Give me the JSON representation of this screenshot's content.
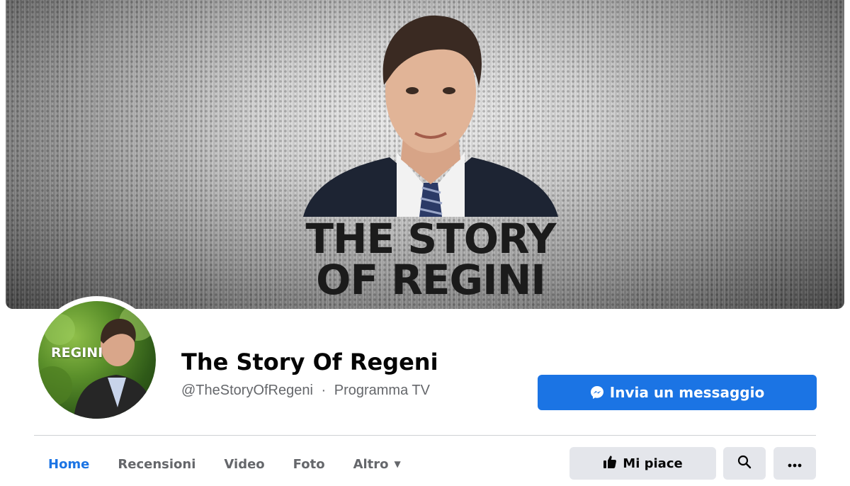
{
  "cover": {
    "title_line1": "THE STORY",
    "title_line2": "OF REGINI"
  },
  "avatar": {
    "label": "REGINI"
  },
  "page": {
    "name": "The Story Of Regeni",
    "handle": "@TheStoryOfRegeni",
    "separator": "·",
    "category": "Programma TV"
  },
  "actions": {
    "message_label": "Invia un messaggio",
    "like_label": "Mi piace",
    "search_icon": "search-icon",
    "more_icon": "more-dots-icon"
  },
  "tabs": [
    {
      "label": "Home",
      "active": true
    },
    {
      "label": "Recensioni",
      "active": false
    },
    {
      "label": "Video",
      "active": false
    },
    {
      "label": "Foto",
      "active": false
    },
    {
      "label": "Altro",
      "active": false
    }
  ],
  "colors": {
    "accent": "#1b74e4",
    "secondary_text": "#65676b",
    "button_grey": "#e4e6eb"
  }
}
